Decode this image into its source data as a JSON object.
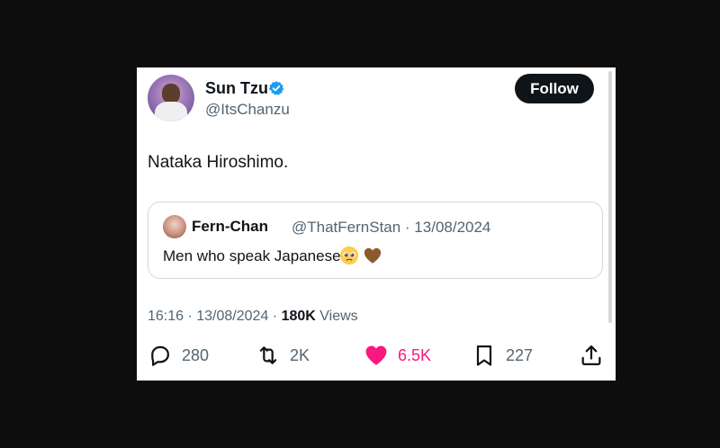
{
  "author": {
    "name": "Sun Tzu",
    "handle": "@ItsChanzu",
    "follow_label": "Follow"
  },
  "tweet": {
    "text": "Nataka Hiroshimo."
  },
  "quote": {
    "name": "Fern-Chan",
    "handle_date": "@ThatFernStan · 13/08/2024",
    "text": "Men who speak Japanese"
  },
  "meta": {
    "time_date": "16:16 · 13/08/2024 · ",
    "views_count": "180K",
    "views_label": " Views"
  },
  "actions": {
    "replies": "280",
    "retweets": "2K",
    "likes": "6.5K",
    "bookmarks": "227"
  },
  "colors": {
    "like": "#f91880",
    "verified": "#1d9bf0",
    "follow_bg": "#0f1419"
  }
}
